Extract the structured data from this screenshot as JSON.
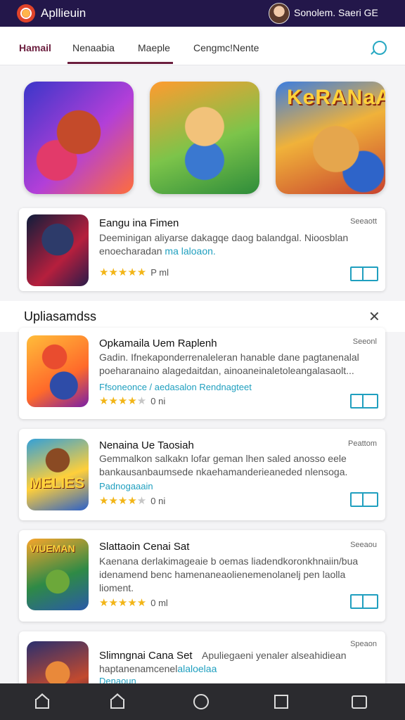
{
  "app": {
    "title": "Apllieuin",
    "user_name": "Sonolem. Saeri GE"
  },
  "tabs": [
    {
      "label": "Hamail"
    },
    {
      "label": "Nenaabia"
    },
    {
      "label": "Maeple"
    },
    {
      "label": "Cengmc!Nente"
    }
  ],
  "featured": [
    {
      "name": "feat-1",
      "icon": "game-hero-icon"
    },
    {
      "name": "feat-2",
      "icon": "game-kid-icon"
    },
    {
      "name": "feat-3",
      "icon": "game-team-icon",
      "title": "KeRANaA"
    }
  ],
  "top_card": {
    "title": "Eangu ina Fimen",
    "tag": "Seeaott",
    "desc_a": "Deeminigan aliyarse dakagqe daog balandgal. Nioosblan",
    "desc_b": "enoecharadan ",
    "desc_hl": "ma laloaon.",
    "rating": "P ml",
    "stars": [
      1,
      1,
      1,
      1,
      1
    ]
  },
  "section": {
    "title": "Upliasamdss"
  },
  "apps": [
    {
      "title": "Opkamaila Uem Raplenh",
      "tag": "Seeonl",
      "desc": "Gadin. Ifnekaponderrenaleleran hanable dane pagtanenalal poeharanaino alagedaitdan, ainoaneinaletoleangalasaolt...",
      "sub": "Ffsoneonce / aedasalon Rendnagteet",
      "rating": "0 ni",
      "stars": [
        1,
        1,
        1,
        1,
        0
      ]
    },
    {
      "title": "Nenaina Ue Taosiah",
      "tag": "Peattom",
      "desc": "Gemmalkon salkakn lofar geman lhen saled anosso eele bankausanbaumsede nkaehamanderieaneded nlensoga.",
      "sub": "Padnogaaain",
      "rating": "0 ni",
      "stars": [
        1,
        1,
        1,
        1,
        0
      ],
      "thumb_word": "MELIES"
    },
    {
      "title": "Slattaoin Cenai Sat",
      "tag": "Seeaou",
      "desc": "Kaenana derlakimageaie b oemas liadendkoronkhnaiin/bua idenamend benc hamenaneaolienemenolanelj pen laolla lioment.",
      "sub": "",
      "rating": "0 ml",
      "stars": [
        1,
        1,
        1,
        1,
        1
      ],
      "thumb_word": "VIUEMAN"
    },
    {
      "title": "Slimngnai Cana Set",
      "tag": "Speaon",
      "desc_a": "Apuliegaeni yenaler alseahidiean",
      "desc_b": "haptanenamcenel",
      "desc_hl": "alaloelaa",
      "sub": "Denaoun",
      "stars": []
    }
  ],
  "bottom_nav": [
    {
      "name": "nav-home-1",
      "icon": "home-icon"
    },
    {
      "name": "nav-home-2",
      "icon": "home-icon"
    },
    {
      "name": "nav-circle",
      "icon": "circle-icon"
    },
    {
      "name": "nav-square",
      "icon": "square-icon"
    },
    {
      "name": "nav-mail",
      "icon": "mail-icon"
    }
  ]
}
